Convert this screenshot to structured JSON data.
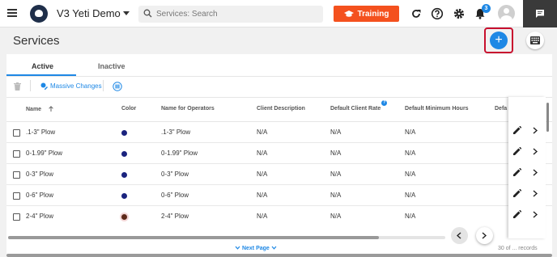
{
  "app": {
    "title": "V3 Yeti Demo"
  },
  "search": {
    "placeholder": "Services: Search"
  },
  "header": {
    "training_label": "Training",
    "notifications_count": "3"
  },
  "page": {
    "title": "Services"
  },
  "tabs": [
    {
      "label": "Active",
      "active": true
    },
    {
      "label": "Inactive",
      "active": false
    }
  ],
  "toolbar": {
    "massive_changes_label": "Massive Changes"
  },
  "columns": [
    "Name",
    "Color",
    "Name for Operators",
    "Client Description",
    "Default Client Rate",
    "Default Minimum Hours",
    "Defa"
  ],
  "rows": [
    {
      "name": ".1-3\" Plow",
      "color": "#1a237e",
      "operator_name": ".1-3\" Plow",
      "client_description": "N/A",
      "client_rate": "N/A",
      "min_hours": "N/A"
    },
    {
      "name": "0-1.99\" Plow",
      "color": "#1a237e",
      "operator_name": "0-1.99\" Plow",
      "client_description": "N/A",
      "client_rate": "N/A",
      "min_hours": "N/A"
    },
    {
      "name": "0-3\" Plow",
      "color": "#1a237e",
      "operator_name": "0-3\" Plow",
      "client_description": "N/A",
      "client_rate": "N/A",
      "min_hours": "N/A"
    },
    {
      "name": "0-6\" Plow",
      "color": "#1a237e",
      "operator_name": "0-6\" Plow",
      "client_description": "N/A",
      "client_rate": "N/A",
      "min_hours": "N/A"
    },
    {
      "name": "2-4\" Plow",
      "color": "#5d2a1a",
      "operator_name": "2-4\" Plow",
      "client_description": "N/A",
      "client_rate": "N/A",
      "min_hours": "N/A"
    }
  ],
  "footer": {
    "next_page_label": "Next Page",
    "records_label": "30 of ... records"
  },
  "colors": {
    "accent": "#1e88e5",
    "training": "#f4511e",
    "highlight": "#c8102e"
  }
}
